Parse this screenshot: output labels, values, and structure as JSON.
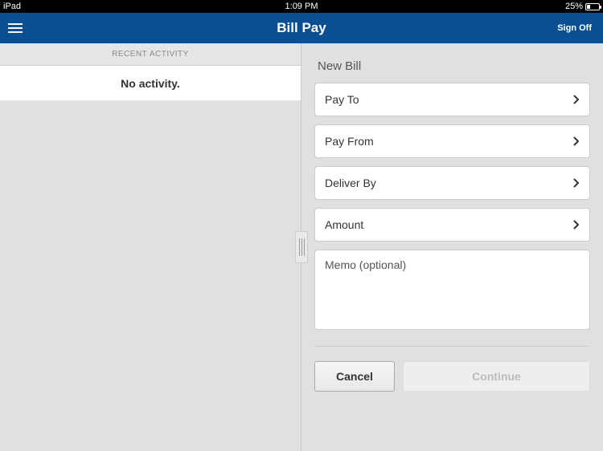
{
  "status": {
    "device": "iPad",
    "time": "1:09 PM",
    "battery": "25%"
  },
  "nav": {
    "title": "Bill Pay",
    "signoff": "Sign Off"
  },
  "left": {
    "sectionHeader": "RECENT ACTIVITY",
    "emptyText": "No activity."
  },
  "form": {
    "header": "New Bill",
    "payTo": "Pay To",
    "payFrom": "Pay From",
    "deliverBy": "Deliver By",
    "amount": "Amount",
    "memoPlaceholder": "Memo (optional)"
  },
  "buttons": {
    "cancel": "Cancel",
    "continue": "Continue"
  }
}
